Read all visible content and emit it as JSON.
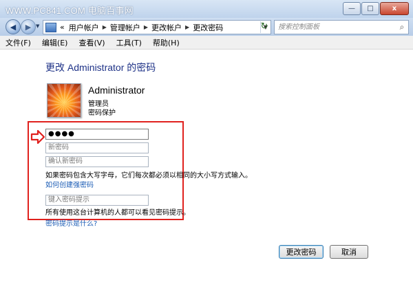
{
  "watermark": "WWW.PC841.COM 电脑百事网",
  "window": {
    "minimize": "—",
    "maximize": "□",
    "close": "x"
  },
  "nav": {
    "breadcrumbs": [
      "«",
      "用户帐户",
      "管理帐户",
      "更改帐户",
      "更改密码"
    ],
    "search_placeholder": "搜索控制面板"
  },
  "menu": [
    "文件(F)",
    "编辑(E)",
    "查看(V)",
    "工具(T)",
    "帮助(H)"
  ],
  "page": {
    "heading": "更改 Administrator 的密码",
    "user_name": "Administrator",
    "user_role": "管理员",
    "user_protection": "密码保护"
  },
  "form": {
    "current_password_value": "●●●●",
    "new_password_placeholder": "新密码",
    "confirm_password_placeholder": "确认新密码",
    "case_note": "如果密码包含大写字母，它们每次都必须以相同的大小写方式输入。",
    "strong_password_link": "如何创建强密码",
    "hint_placeholder": "键入密码提示",
    "hint_note": "所有使用这台计算机的人都可以看见密码提示。",
    "hint_link": "密码提示是什么?"
  },
  "buttons": {
    "change": "更改密码",
    "cancel": "取消"
  },
  "colors": {
    "highlight_border": "#e0201d",
    "link": "#1b5cb5",
    "heading": "#1e3287"
  }
}
